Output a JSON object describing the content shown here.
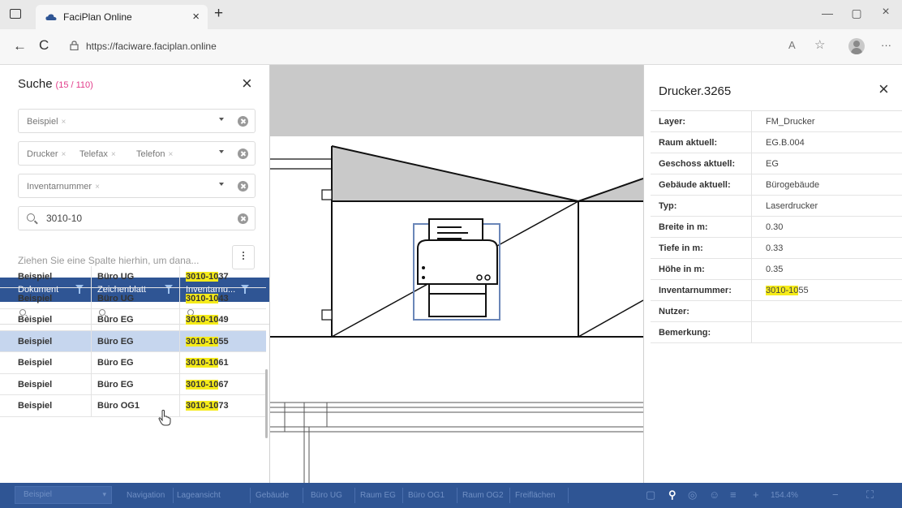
{
  "browser": {
    "tab_title": "FaciPlan Online",
    "tab_close": "×",
    "new_tab": "+",
    "url": "https://faciware.faciplan.online",
    "back": "←",
    "reload": "C",
    "minimize": "—",
    "maximize": "▢",
    "close": "×",
    "read_aloud": "A",
    "favorites": "☆",
    "more": "···"
  },
  "search": {
    "title": "Suche",
    "count": "(15 / 110)",
    "close": "×",
    "filters": [
      {
        "tags": [
          "Beispiel"
        ]
      },
      {
        "tags": [
          "Drucker",
          "Telefax",
          "Telefon"
        ]
      },
      {
        "tags": [
          "Inventarnummer"
        ]
      }
    ],
    "tag_remove": "×",
    "query": "3010-10",
    "group_hint": "Ziehen Sie eine Spalte hierhin, um dana...",
    "columns": [
      "Dokument",
      "Zeichenblatt",
      "Inventarnu..."
    ],
    "rows": [
      {
        "dokument": "Beispiel",
        "blatt": "Büro UG",
        "inv_hl": "3010-10",
        "inv_rest": "37"
      },
      {
        "dokument": "Beispiel",
        "blatt": "Büro UG",
        "inv_hl": "3010-10",
        "inv_rest": "43"
      },
      {
        "dokument": "Beispiel",
        "blatt": "Büro EG",
        "inv_hl": "3010-10",
        "inv_rest": "49"
      },
      {
        "dokument": "Beispiel",
        "blatt": "Büro EG",
        "inv_hl": "3010-10",
        "inv_rest": "55"
      },
      {
        "dokument": "Beispiel",
        "blatt": "Büro EG",
        "inv_hl": "3010-10",
        "inv_rest": "61"
      },
      {
        "dokument": "Beispiel",
        "blatt": "Büro EG",
        "inv_hl": "3010-10",
        "inv_rest": "67"
      },
      {
        "dokument": "Beispiel",
        "blatt": "Büro OG1",
        "inv_hl": "3010-10",
        "inv_rest": "73"
      }
    ],
    "selected_row": 3
  },
  "detail": {
    "title": "Drucker.3265",
    "close": "×",
    "props": [
      {
        "k": "Layer:",
        "v": "FM_Drucker"
      },
      {
        "k": "Raum aktuell:",
        "v": "EG.B.004"
      },
      {
        "k": "Geschoss aktuell:",
        "v": "EG"
      },
      {
        "k": "Gebäude aktuell:",
        "v": "Bürogebäude"
      },
      {
        "k": "Typ:",
        "v": "Laserdrucker"
      },
      {
        "k": "Breite in m:",
        "v": "0.30"
      },
      {
        "k": "Tiefe in m:",
        "v": "0.33"
      },
      {
        "k": "Höhe in m:",
        "v": "0.35"
      },
      {
        "k": "Inventarnummer:",
        "v_hl": "3010-10",
        "v_rest": "55"
      },
      {
        "k": "Nutzer:",
        "v": ""
      },
      {
        "k": "Bemerkung:",
        "v": ""
      }
    ]
  },
  "toolbar": {
    "select_value": "Beispiel",
    "items": [
      "Navigation",
      "Lageansicht",
      "Gebäude",
      "Büro UG",
      "Raum EG",
      "Büro OG1",
      "Raum OG2",
      "Freiflächen"
    ],
    "zoom": "154.4%"
  },
  "colors": {
    "accent": "#2f5594",
    "highlight": "#f5eb19",
    "selected_row": "#c6d6ee"
  }
}
